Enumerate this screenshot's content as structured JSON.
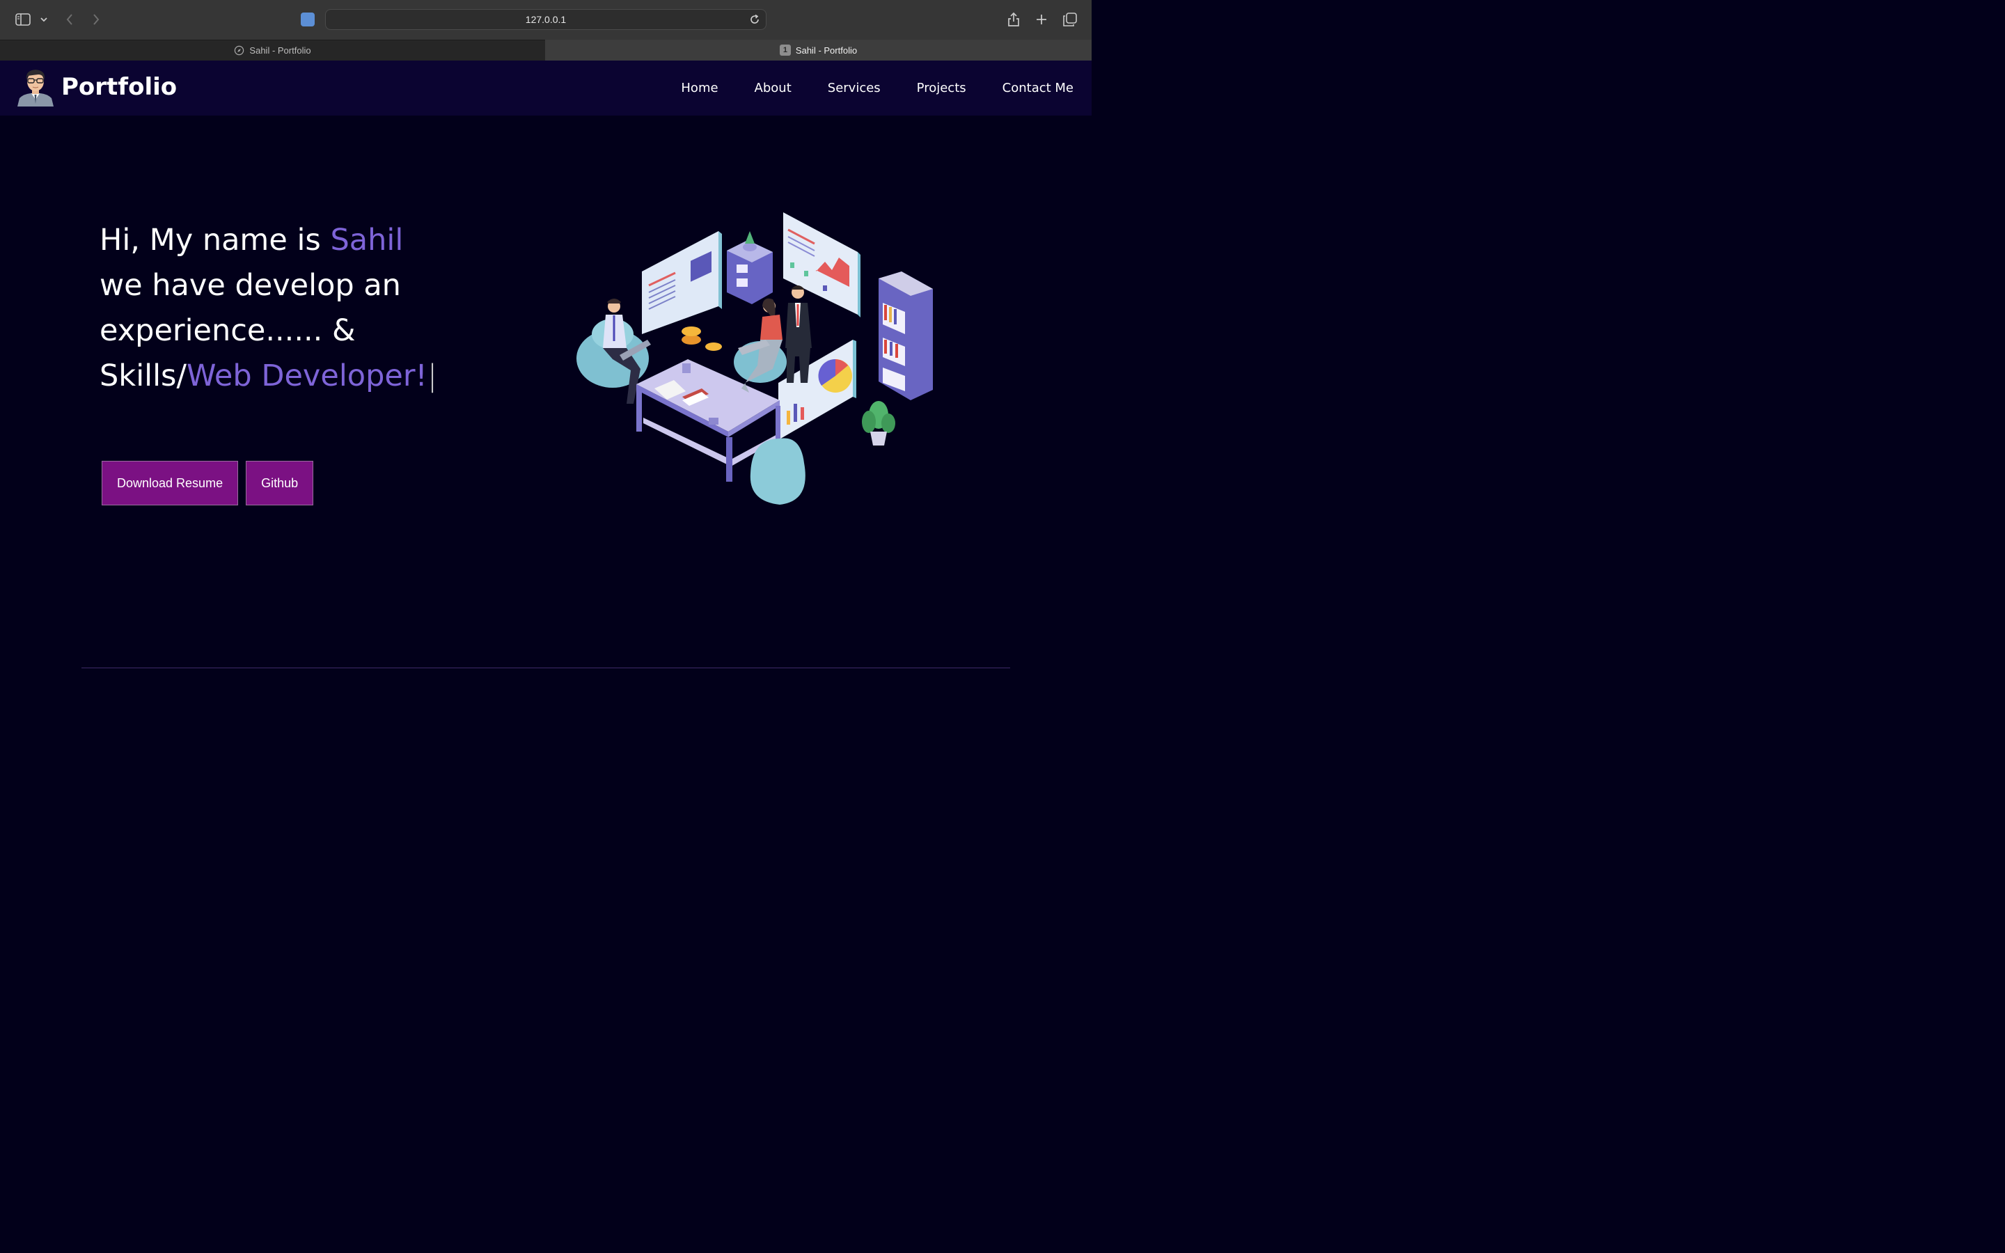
{
  "browser": {
    "url": "127.0.0.1",
    "tabs": [
      {
        "title": "Sahil - Portfolio"
      },
      {
        "number": "1",
        "title": "Sahil - Portfolio"
      }
    ]
  },
  "navbar": {
    "brand": "Portfolio",
    "links": [
      "Home",
      "About",
      "Services",
      "Projects",
      "Contact Me"
    ]
  },
  "hero": {
    "line1_prefix": "Hi, My name is ",
    "name": "Sahil",
    "line2": "we have develop an",
    "line3": "experience...... &",
    "line4_prefix": "Skills/",
    "role": "Web Developer!",
    "caret": "|"
  },
  "buttons": {
    "resume": "Download Resume",
    "github": "Github"
  },
  "colors": {
    "background": "#02001a",
    "navbar": "#0b0431",
    "accent": "#7e64d8",
    "button": "#7b1183"
  }
}
